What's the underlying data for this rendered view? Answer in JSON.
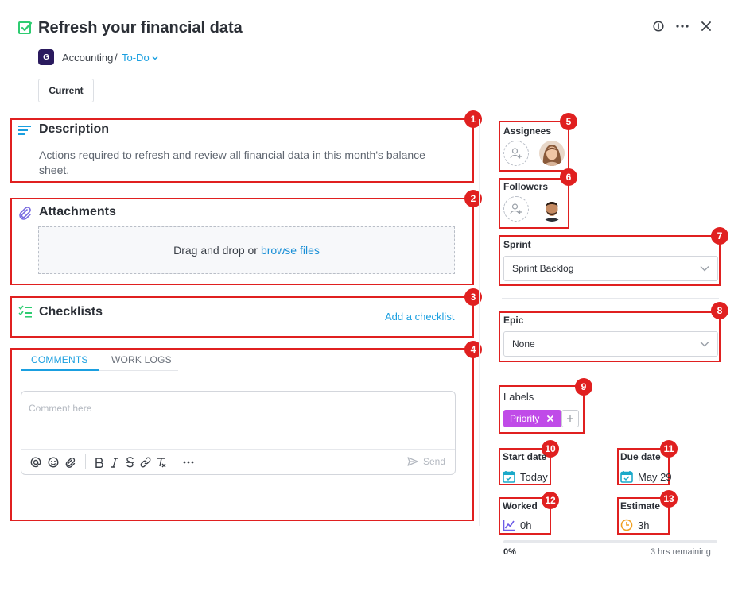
{
  "task": {
    "title": "Refresh your financial data",
    "project": "Accounting",
    "project_initial": "G",
    "separator": "/",
    "status": "To-Do",
    "version": "Current"
  },
  "description": {
    "title": "Description",
    "text": "Actions required to refresh and review all financial data in this month's balance sheet."
  },
  "attachments": {
    "title": "Attachments",
    "drop_text": "Drag and drop or",
    "browse_link": "browse files"
  },
  "checklists": {
    "title": "Checklists",
    "add_link": "Add a checklist"
  },
  "activity": {
    "tabs": [
      "COMMENTS",
      "WORK LOGS"
    ],
    "active_tab": "COMMENTS",
    "comment_placeholder": "Comment here",
    "send_label": "Send"
  },
  "sidebar": {
    "assignees_label": "Assignees",
    "followers_label": "Followers",
    "sprint_label": "Sprint",
    "sprint_value": "Sprint Backlog",
    "epic_label": "Epic",
    "epic_value": "None",
    "labels_label": "Labels",
    "tags": [
      {
        "text": "Priority",
        "color": "#c04be8"
      }
    ],
    "start_date_label": "Start date",
    "start_date_value": "Today",
    "due_date_label": "Due date",
    "due_date_value": "May 29",
    "worked_label": "Worked",
    "worked_value": "0h",
    "estimate_label": "Estimate",
    "estimate_value": "3h",
    "progress_percent": 0,
    "progress_text": "0%",
    "remaining_text": "3 hrs remaining"
  },
  "annotations": [
    "1",
    "2",
    "3",
    "4",
    "5",
    "6",
    "7",
    "8",
    "9",
    "10",
    "11",
    "12",
    "13"
  ],
  "colors": {
    "accent": "#1a9fe0",
    "annotation": "#e02020",
    "task_icon": "#2ecc71",
    "tag": "#c04be8",
    "worked_icon": "#6c5ce7",
    "estimate_icon": "#f0a020"
  }
}
